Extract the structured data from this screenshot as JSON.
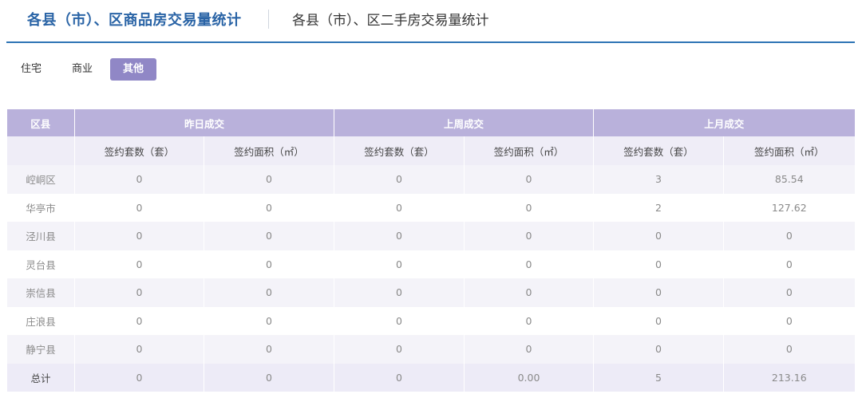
{
  "header": {
    "active_tab": "各县（市）、区商品房交易量统计",
    "secondary_tab": "各县（市）、区二手房交易量统计"
  },
  "subtabs": [
    {
      "label": "住宅",
      "active": false
    },
    {
      "label": "商业",
      "active": false
    },
    {
      "label": "其他",
      "active": true
    }
  ],
  "colors": {
    "accent": "#2e74b5",
    "header_purple": "#b9b1db",
    "active_tab": "#9087c6"
  },
  "table": {
    "district_header": "区县",
    "groups": [
      "昨日成交",
      "上周成交",
      "上月成交"
    ],
    "subheaders": [
      "签约套数（套）",
      "签约面积（㎡）",
      "签约套数（套）",
      "签约面积（㎡）",
      "签约套数（套）",
      "签约面积（㎡）"
    ],
    "rows": [
      {
        "district": "崆峒区",
        "values": [
          "0",
          "0",
          "0",
          "0",
          "3",
          "85.54"
        ]
      },
      {
        "district": "华亭市",
        "values": [
          "0",
          "0",
          "0",
          "0",
          "2",
          "127.62"
        ]
      },
      {
        "district": "泾川县",
        "values": [
          "0",
          "0",
          "0",
          "0",
          "0",
          "0"
        ]
      },
      {
        "district": "灵台县",
        "values": [
          "0",
          "0",
          "0",
          "0",
          "0",
          "0"
        ]
      },
      {
        "district": "崇信县",
        "values": [
          "0",
          "0",
          "0",
          "0",
          "0",
          "0"
        ]
      },
      {
        "district": "庄浪县",
        "values": [
          "0",
          "0",
          "0",
          "0",
          "0",
          "0"
        ]
      },
      {
        "district": "静宁县",
        "values": [
          "0",
          "0",
          "0",
          "0",
          "0",
          "0"
        ]
      }
    ],
    "total": {
      "district": "总计",
      "values": [
        "0",
        "0",
        "0",
        "0.00",
        "5",
        "213.16"
      ]
    }
  }
}
